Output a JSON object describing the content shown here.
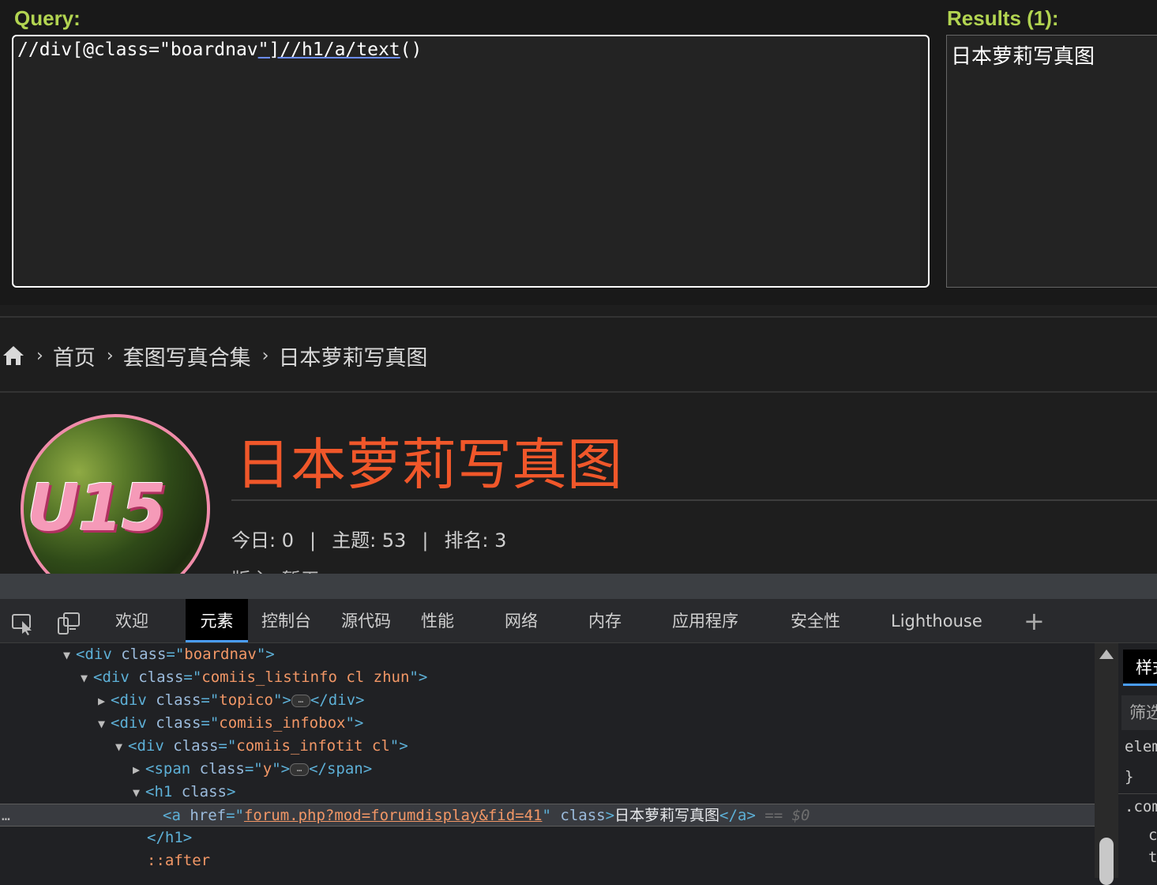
{
  "xpath_helper": {
    "query_label": "Query:",
    "query_parts": [
      "//div[@class=\"boardnav",
      "\"]//h1/a/text",
      "()"
    ],
    "results_label": "Results (1):",
    "results_text": "日本萝莉写真图"
  },
  "page": {
    "breadcrumb": {
      "home_icon": "home-icon",
      "items": [
        "首页",
        "套图写真合集",
        "日本萝莉写真图"
      ],
      "separator": "›"
    },
    "avatar_text": "U15",
    "forum_title": "日本萝莉写真图",
    "stats": {
      "today": "今日: 0",
      "topics": "主题: 53",
      "rank": "排名: 3",
      "divider": "|"
    },
    "moderator": "版主: 暂无"
  },
  "devtools": {
    "tabs": [
      "欢迎",
      "元素",
      "控制台",
      "源代码",
      "性能",
      "网络",
      "内存",
      "应用程序",
      "安全性",
      "Lighthouse"
    ],
    "active_tab": "元素",
    "plus": "+",
    "icons": [
      "inspect-element-icon",
      "device-emulation-icon"
    ],
    "dom": {
      "r1": {
        "open": "<div",
        "attr": " class",
        "eq": "=\"",
        "val": "boardnav",
        "close": "\">"
      },
      "r2": {
        "open": "<div",
        "attr": " class",
        "eq": "=\"",
        "val": "comiis_listinfo cl zhun",
        "close": "\">"
      },
      "r3": {
        "open": "<div",
        "attr": " class",
        "eq": "=\"",
        "val": "topico",
        "close": "\">",
        "ellipsis": "…",
        "end": "</div>"
      },
      "r4": {
        "open": "<div",
        "attr": " class",
        "eq": "=\"",
        "val": "comiis_infobox",
        "close": "\">"
      },
      "r5": {
        "open": "<div",
        "attr": " class",
        "eq": "=\"",
        "val": "comiis_infotit cl",
        "close": "\">"
      },
      "r6": {
        "open": "<span",
        "attr": " class",
        "eq": "=\"",
        "val": "y",
        "close": "\">",
        "ellipsis": "…",
        "end": "</span>"
      },
      "r7": {
        "open": "<h1",
        "attr": " class",
        "close": ">"
      },
      "r8": {
        "open": "<a",
        "attr1": " href",
        "eq": "=\"",
        "href": "forum.php?mod=forumdisplay&fid=41",
        "q": "\"",
        "attr2": " class",
        "close": ">",
        "text": "日本萝莉写真图",
        "end": "</a>",
        "eq0": " == ",
        "dollar": "$0",
        "dots": "…"
      },
      "r9": {
        "end": "</h1>"
      },
      "r10": {
        "pseudo": "::after"
      }
    },
    "side_panel": {
      "tab": "样式",
      "filter_placeholder": "筛选",
      "lines": [
        "elem",
        "}",
        ".com",
        "c",
        "t"
      ]
    }
  }
}
